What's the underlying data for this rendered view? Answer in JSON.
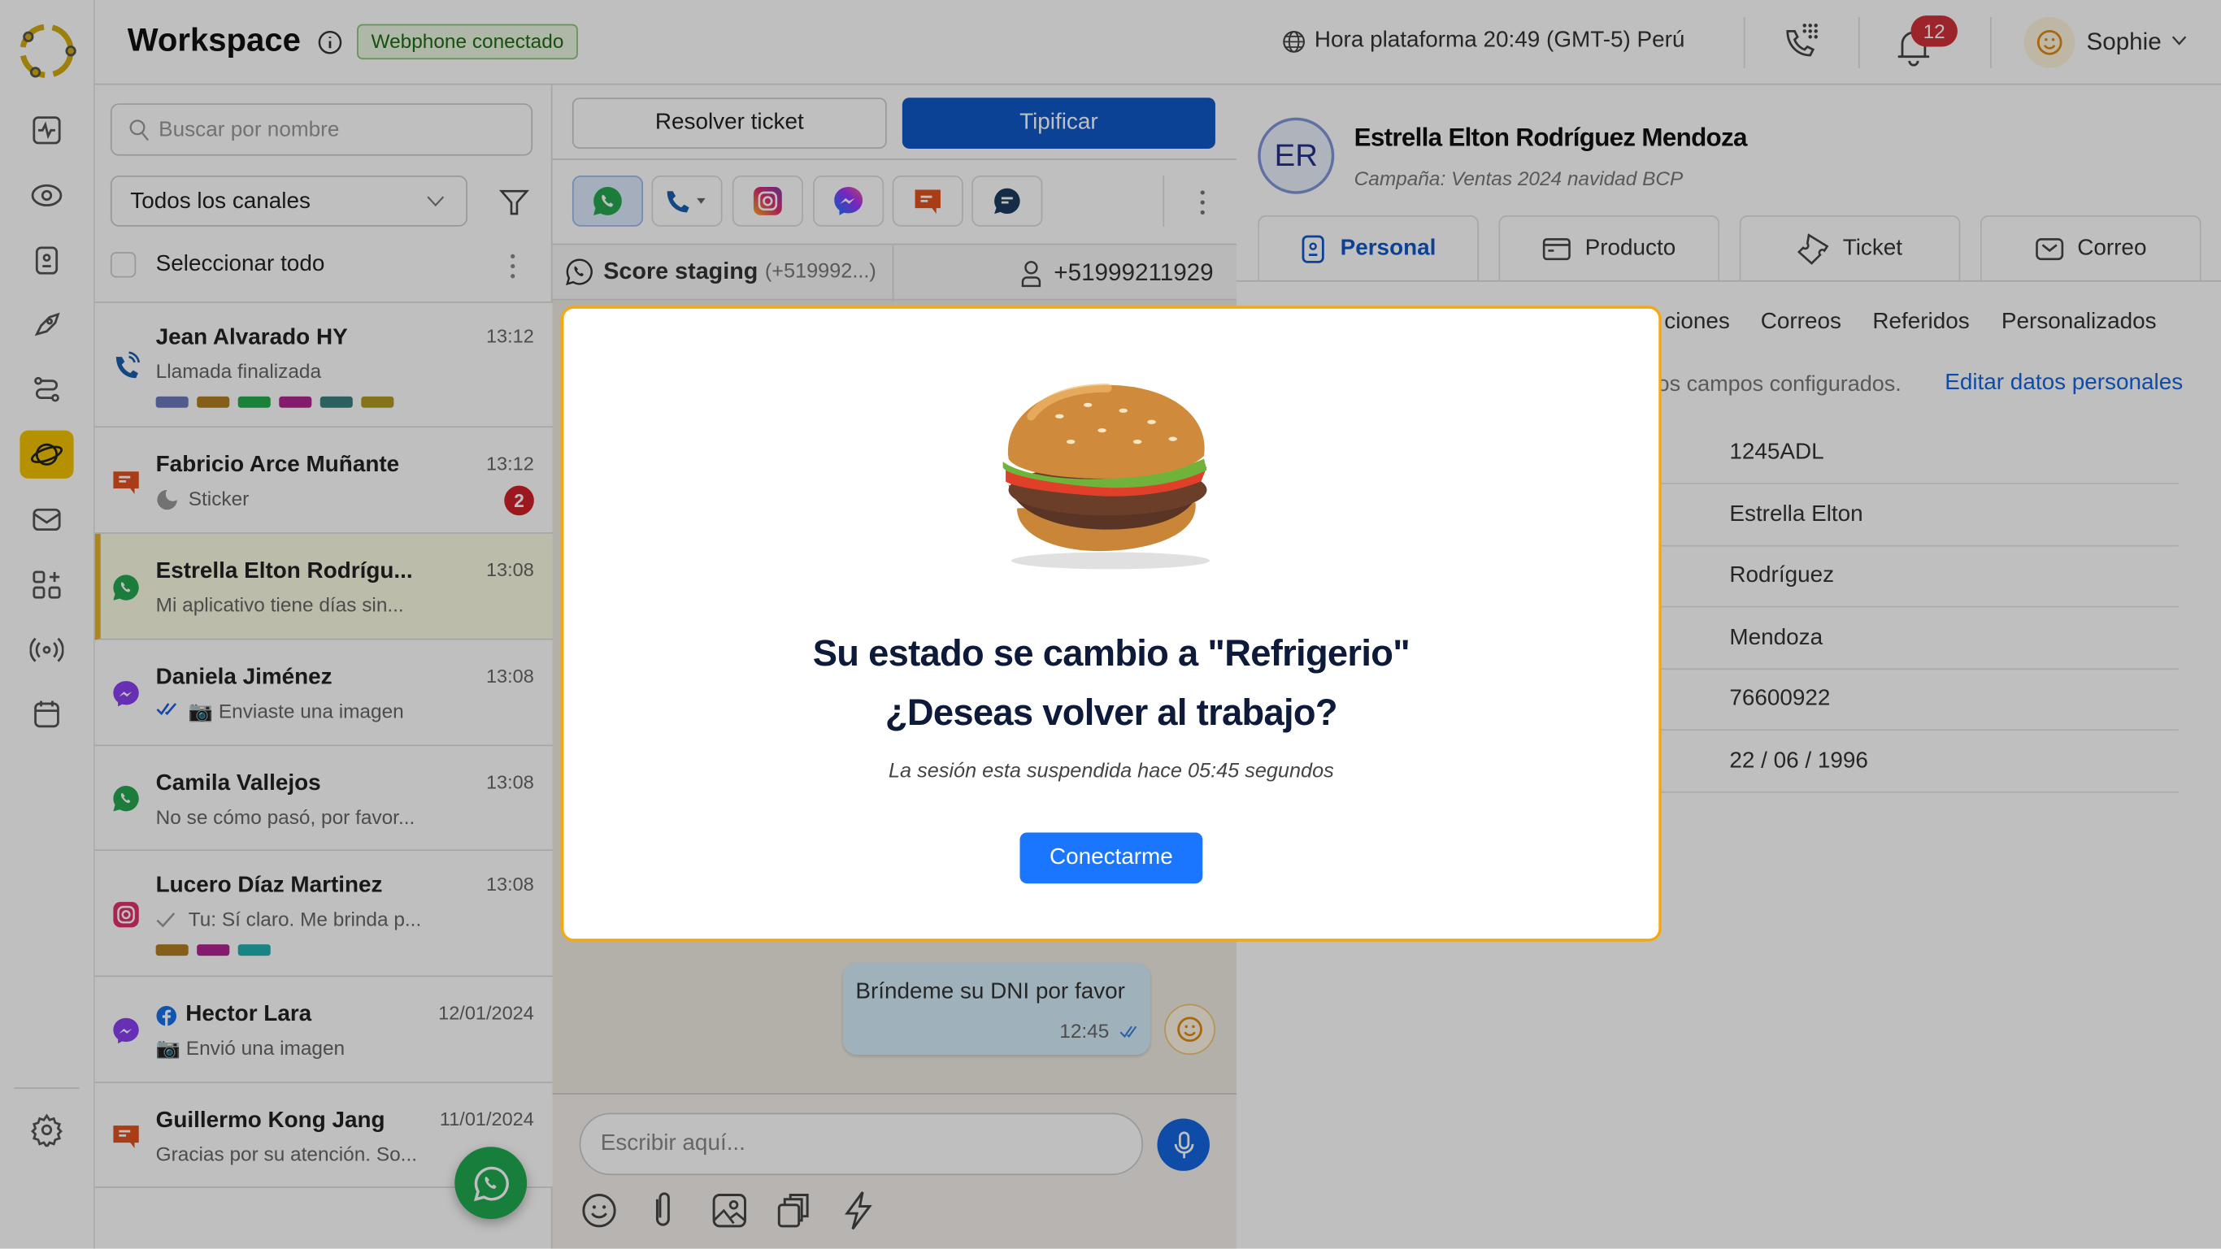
{
  "header": {
    "title": "Workspace",
    "status_badge": "Webphone conectado",
    "platform_time": "Hora plataforma 20:49 (GMT-5) Perú",
    "notification_count": "12",
    "user_name": "Sophie"
  },
  "rail": {
    "items": [
      "activity",
      "eye",
      "contacts",
      "rocket",
      "flows",
      "workspace",
      "mail",
      "apps",
      "broadcast",
      "calendar"
    ],
    "active": "workspace",
    "settings": "settings"
  },
  "list": {
    "search_placeholder": "Buscar por nombre",
    "channel_filter": "Todos los canales",
    "select_all": "Seleccionar todo",
    "items": [
      {
        "name": "Jean Alvarado HY",
        "time": "13:12",
        "preview": "Llamada finalizada",
        "channel": "phone",
        "tags": [
          "#6b79bd",
          "#b27f22",
          "#22ad4b",
          "#b02590",
          "#3b817f",
          "#b19a22"
        ]
      },
      {
        "name": "Fabricio Arce Muñante",
        "time": "13:12",
        "preview": "Sticker",
        "channel": "chat",
        "unread": "2"
      },
      {
        "name": "Estrella Elton Rodrígu...",
        "time": "13:08",
        "preview": "Mi aplicativo tiene días sin...",
        "channel": "whatsapp",
        "selected": true
      },
      {
        "name": "Daniela Jiménez",
        "time": "13:08",
        "preview": "📷 Enviaste una imagen",
        "channel": "messenger"
      },
      {
        "name": "Camila Vallejos",
        "time": "13:08",
        "preview": "No se cómo pasó, por favor...",
        "channel": "whatsapp"
      },
      {
        "name": "Lucero Díaz Martinez",
        "time": "13:08",
        "preview": "Tu: Sí claro. Me brinda p...",
        "channel": "instagram",
        "tags": [
          "#b27f22",
          "#b02590",
          "#22b0b0"
        ]
      },
      {
        "name": "Hector Lara",
        "time": "12/01/2024",
        "preview": "📷 Envió una imagen",
        "channel": "messenger"
      },
      {
        "name": "Guillermo Kong Jang",
        "time": "11/01/2024",
        "preview": "Gracias por su atención. So...",
        "channel": "chat"
      }
    ]
  },
  "chat": {
    "resolve_label": "Resolver ticket",
    "tipify_label": "Tipificar",
    "channels": [
      "whatsapp",
      "phone",
      "instagram",
      "messenger",
      "chat",
      "webchat"
    ],
    "line_name": "Score staging",
    "line_number": "(+519992...)",
    "contact_phone": "+51999211929",
    "message": {
      "text": "Bríndeme su DNI por favor",
      "time": "12:45"
    },
    "input_placeholder": "Escribir aquí..."
  },
  "contact": {
    "initials": "ER",
    "name": "Estrella Elton Rodríguez Mendoza",
    "campaign": "Campaña: Ventas 2024 navidad BCP",
    "tabs": [
      "Personal",
      "Producto",
      "Ticket",
      "Correo"
    ],
    "active_tab": "Personal",
    "subtabs": [
      "ciones",
      "Correos",
      "Referidos",
      "Personalizados"
    ],
    "info_text": "os campos configurados.",
    "edit_link": "Editar datos personales",
    "values": [
      "1245ADL",
      "Estrella Elton",
      "Rodríguez",
      "Mendoza",
      "76600922",
      "22 / 06 / 1996"
    ]
  },
  "modal": {
    "title_line1": "Su estado se cambio a \"Refrigerio\"",
    "title_line2": "¿Deseas volver al trabajo?",
    "subtitle": "La sesión esta suspendida hace 05:45 segundos",
    "button": "Conectarme"
  },
  "colors": {
    "primary": "#1058c8",
    "modal_button": "#1a76ff",
    "accent": "#f2c200",
    "modal_border": "#f5a80f",
    "unread": "#d0202a"
  }
}
